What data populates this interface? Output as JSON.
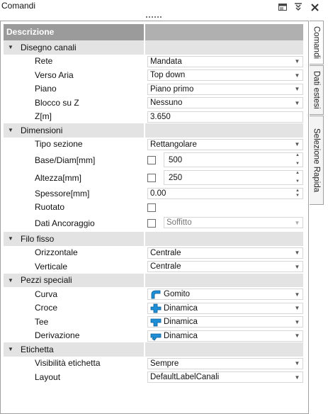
{
  "window": {
    "title": "Comandi"
  },
  "header": {
    "col1": "Descrizione",
    "col2": ""
  },
  "categories": {
    "disegno": {
      "label": "Disegno canali",
      "rete_label": "Rete",
      "rete_value": "Mandata",
      "verso_label": "Verso Aria",
      "verso_value": "Top down",
      "piano_label": "Piano",
      "piano_value": "Piano primo",
      "blocco_label": "Blocco su Z",
      "blocco_value": "Nessuno",
      "z_label": "Z[m]",
      "z_value": "3.650"
    },
    "dimensioni": {
      "label": "Dimensioni",
      "tipo_label": "Tipo sezione",
      "tipo_value": "Rettangolare",
      "base_label": "Base/Diam[mm]",
      "base_value": "500",
      "altezza_label": "Altezza[mm]",
      "altezza_value": "250",
      "spessore_label": "Spessore[mm]",
      "spessore_value": "0.00",
      "ruotato_label": "Ruotato",
      "ancoraggio_label": "Dati Ancoraggio",
      "ancoraggio_value": "Soffitto"
    },
    "filo": {
      "label": "Filo fisso",
      "orizz_label": "Orizzontale",
      "orizz_value": "Centrale",
      "vert_label": "Verticale",
      "vert_value": "Centrale"
    },
    "pezzi": {
      "label": "Pezzi speciali",
      "curva_label": "Curva",
      "curva_value": "Gomito",
      "croce_label": "Croce",
      "croce_value": "Dinamica",
      "tee_label": "Tee",
      "tee_value": "Dinamica",
      "deriv_label": "Derivazione",
      "deriv_value": "Dinamica"
    },
    "etichetta": {
      "label": "Etichetta",
      "vis_label": "Visibilità etichetta",
      "vis_value": "Sempre",
      "layout_label": "Layout",
      "layout_value": "DefaultLabelCanali"
    }
  },
  "tabs": [
    "Comandi",
    "Dati estesi",
    "Selezione Rapida"
  ],
  "colors": {
    "header_bg": "#9b9b9b",
    "category_bg": "#e3e3e3",
    "duct_icon": "#1e8fd6"
  }
}
